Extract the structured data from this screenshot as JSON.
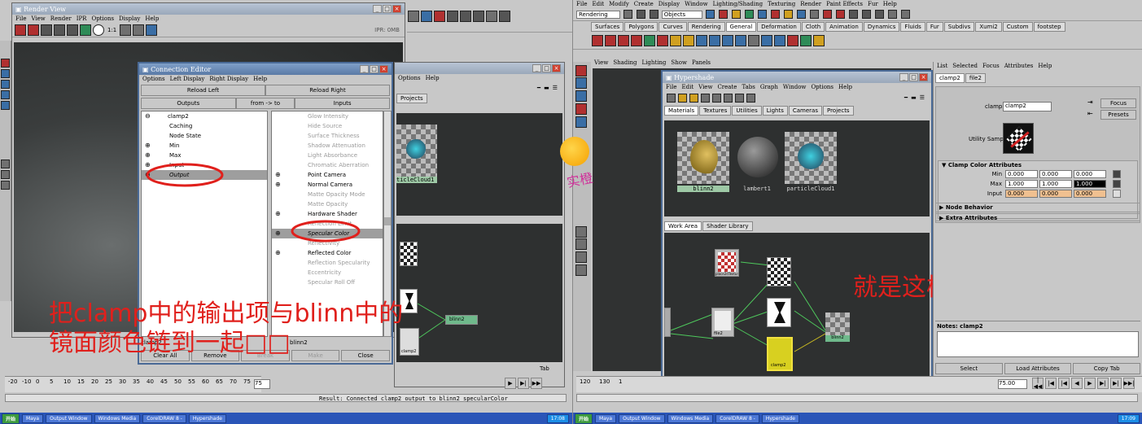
{
  "left": {
    "main_menu": [
      "File",
      "Edit",
      "Modify",
      "Create",
      "Display",
      "Window",
      "Lighting/Shading",
      "Texturing",
      "Render",
      "Paint Effects",
      "Fur",
      "Help"
    ],
    "render_view": {
      "title": "Render View",
      "menu": [
        "File",
        "View",
        "Render",
        "IPR",
        "Options",
        "Display",
        "Help"
      ],
      "zoom": "1:1",
      "status": "IPR: 0MB"
    },
    "connection_editor": {
      "title": "Connection Editor",
      "menu": [
        "Options",
        "Left Display",
        "Right Display",
        "Help"
      ],
      "reload_left": "Reload Left",
      "reload_right": "Reload Right",
      "outputs": "Outputs",
      "from_to": "from -> to",
      "inputs": "Inputs",
      "left_items": [
        {
          "label": "clamp2",
          "prefix": "⊖",
          "indent": 0
        },
        {
          "label": "Caching",
          "prefix": "",
          "indent": 1
        },
        {
          "label": "Node State",
          "prefix": "",
          "indent": 1
        },
        {
          "label": "Min",
          "prefix": "⊕",
          "indent": 1
        },
        {
          "label": "Max",
          "prefix": "⊕",
          "indent": 1
        },
        {
          "label": "Input",
          "prefix": "⊕",
          "indent": 1
        },
        {
          "label": "Output",
          "prefix": "⊕",
          "indent": 1,
          "selected": true
        }
      ],
      "right_items": [
        {
          "label": "Glow Intensity",
          "dim": true,
          "prefix": ""
        },
        {
          "label": "Hide Source",
          "dim": true,
          "prefix": ""
        },
        {
          "label": "Surface Thickness",
          "dim": true,
          "prefix": ""
        },
        {
          "label": "Shadow Attenuation",
          "dim": true,
          "prefix": ""
        },
        {
          "label": "Light Absorbance",
          "dim": true,
          "prefix": ""
        },
        {
          "label": "Chromatic Aberration",
          "dim": true,
          "prefix": ""
        },
        {
          "label": "Point Camera",
          "dim": false,
          "prefix": "⊕"
        },
        {
          "label": "Normal Camera",
          "dim": false,
          "prefix": "⊕"
        },
        {
          "label": "Matte Opacity Mode",
          "dim": true,
          "prefix": ""
        },
        {
          "label": "Matte Opacity",
          "dim": true,
          "prefix": ""
        },
        {
          "label": "Hardware Shader",
          "dim": false,
          "prefix": "⊕"
        },
        {
          "label": "Reflection Limit",
          "dim": true,
          "prefix": ""
        },
        {
          "label": "Specular Color",
          "dim": false,
          "prefix": "⊕",
          "selected": true
        },
        {
          "label": "Reflectivity",
          "dim": true,
          "prefix": ""
        },
        {
          "label": "Reflected Color",
          "dim": false,
          "prefix": "⊕"
        },
        {
          "label": "Reflection Specularity",
          "dim": true,
          "prefix": ""
        },
        {
          "label": "Eccentricity",
          "dim": true,
          "prefix": ""
        },
        {
          "label": "Specular Roll Off",
          "dim": true,
          "prefix": ""
        }
      ],
      "left_footer": "clamp2",
      "right_footer": "blinn2",
      "buttons": [
        "Clear All",
        "Remove",
        "Break",
        "Make",
        "Close"
      ]
    },
    "hypershade_back": {
      "menu": [
        "Options",
        "Help"
      ],
      "tab": "Projects",
      "swatch_label": "ticleCloud1",
      "node_labels": [
        "blinn2",
        "clamp2"
      ],
      "tab_label": "Tab"
    },
    "annotation": {
      "line1": "把clamp中的输出项与blinn中的",
      "line2": "镜面颜色链到一起□□"
    },
    "timeline_ticks": [
      "-20",
      "-10",
      "0",
      "5",
      "10",
      "15",
      "20",
      "25",
      "30",
      "35",
      "40",
      "45",
      "50",
      "55",
      "60",
      "65",
      "70",
      "75"
    ],
    "time_value": "75",
    "command_result": "Result: Connected clamp2 output to blinn2 specularColor",
    "taskbar": [
      "开始",
      "Maya",
      "Output Window",
      "Windows Media",
      "CorelDRAW 8 -",
      "Hypershade"
    ],
    "clock": "17:08"
  },
  "right": {
    "main_menu": [
      "File",
      "Edit",
      "Modify",
      "Create",
      "Display",
      "Window",
      "Lighting/Shading",
      "Texturing",
      "Render",
      "Paint Effects",
      "Fur",
      "Help"
    ],
    "mode": "Rendering",
    "objects": "Objects",
    "shelf_tabs": [
      "Surfaces",
      "Polygons",
      "Curves",
      "Rendering",
      "General",
      "Deformation",
      "Cloth",
      "Animation",
      "Dynamics",
      "Fluids",
      "Fur",
      "Subdivs",
      "Xumi2",
      "Custom",
      "footstep"
    ],
    "active_shelf": "General",
    "panel_menu": [
      "View",
      "Shading",
      "Lighting",
      "Show",
      "Panels"
    ],
    "hypershade": {
      "title": "Hypershade",
      "menu": [
        "File",
        "Edit",
        "View",
        "Create",
        "Tabs",
        "Graph",
        "Window",
        "Options",
        "Help"
      ],
      "top_tabs": [
        "Materials",
        "Textures",
        "Utilities",
        "Lights",
        "Cameras",
        "Projects"
      ],
      "materials": [
        "blinn2",
        "lambert1",
        "particleCloud1"
      ],
      "bottom_tabs": [
        "Work Area",
        "Shader Library"
      ],
      "nodes": [
        "place2dTexture",
        "file2",
        "clamp2",
        "blinn2"
      ]
    },
    "annotation": "就是这样的",
    "attribute_editor": {
      "menu": [
        "List",
        "Selected",
        "Focus",
        "Attributes",
        "Help"
      ],
      "tabs": [
        "clamp2",
        "file2"
      ],
      "node_label": "clamp:",
      "node_name": "clamp2",
      "focus": "Focus",
      "presets": "Presets",
      "sample_label": "Utility Sample",
      "section": "Clamp Color Attributes",
      "rows": [
        {
          "label": "Min",
          "values": [
            "0.000",
            "0.000",
            "0.000"
          ]
        },
        {
          "label": "Max",
          "values": [
            "1.000",
            "1.000",
            "1.000"
          ]
        },
        {
          "label": "Input",
          "values": [
            "0.000",
            "0.000",
            "0.000"
          ]
        }
      ],
      "collapsed": [
        "Node Behavior",
        "Extra Attributes"
      ],
      "notes": "Notes: clamp2",
      "buttons": [
        "Select",
        "Load Attributes",
        "Copy Tab"
      ]
    },
    "timeline_ticks": [
      "120",
      "130",
      "1"
    ],
    "time_value": "75.00",
    "taskbar": [
      "开始",
      "Maya",
      "Output Window",
      "Windows Media",
      "CorelDRAW 8 -",
      "Hypershade"
    ],
    "clock": "17:09",
    "mascot_text": "实橙"
  },
  "colors": {
    "annotation_red": "#e0201c",
    "title_blue": "#5a7aa6",
    "panel_dark": "#2e3030",
    "input_orange": "#f0c090",
    "taskbar_blue": "#2a55b8"
  }
}
